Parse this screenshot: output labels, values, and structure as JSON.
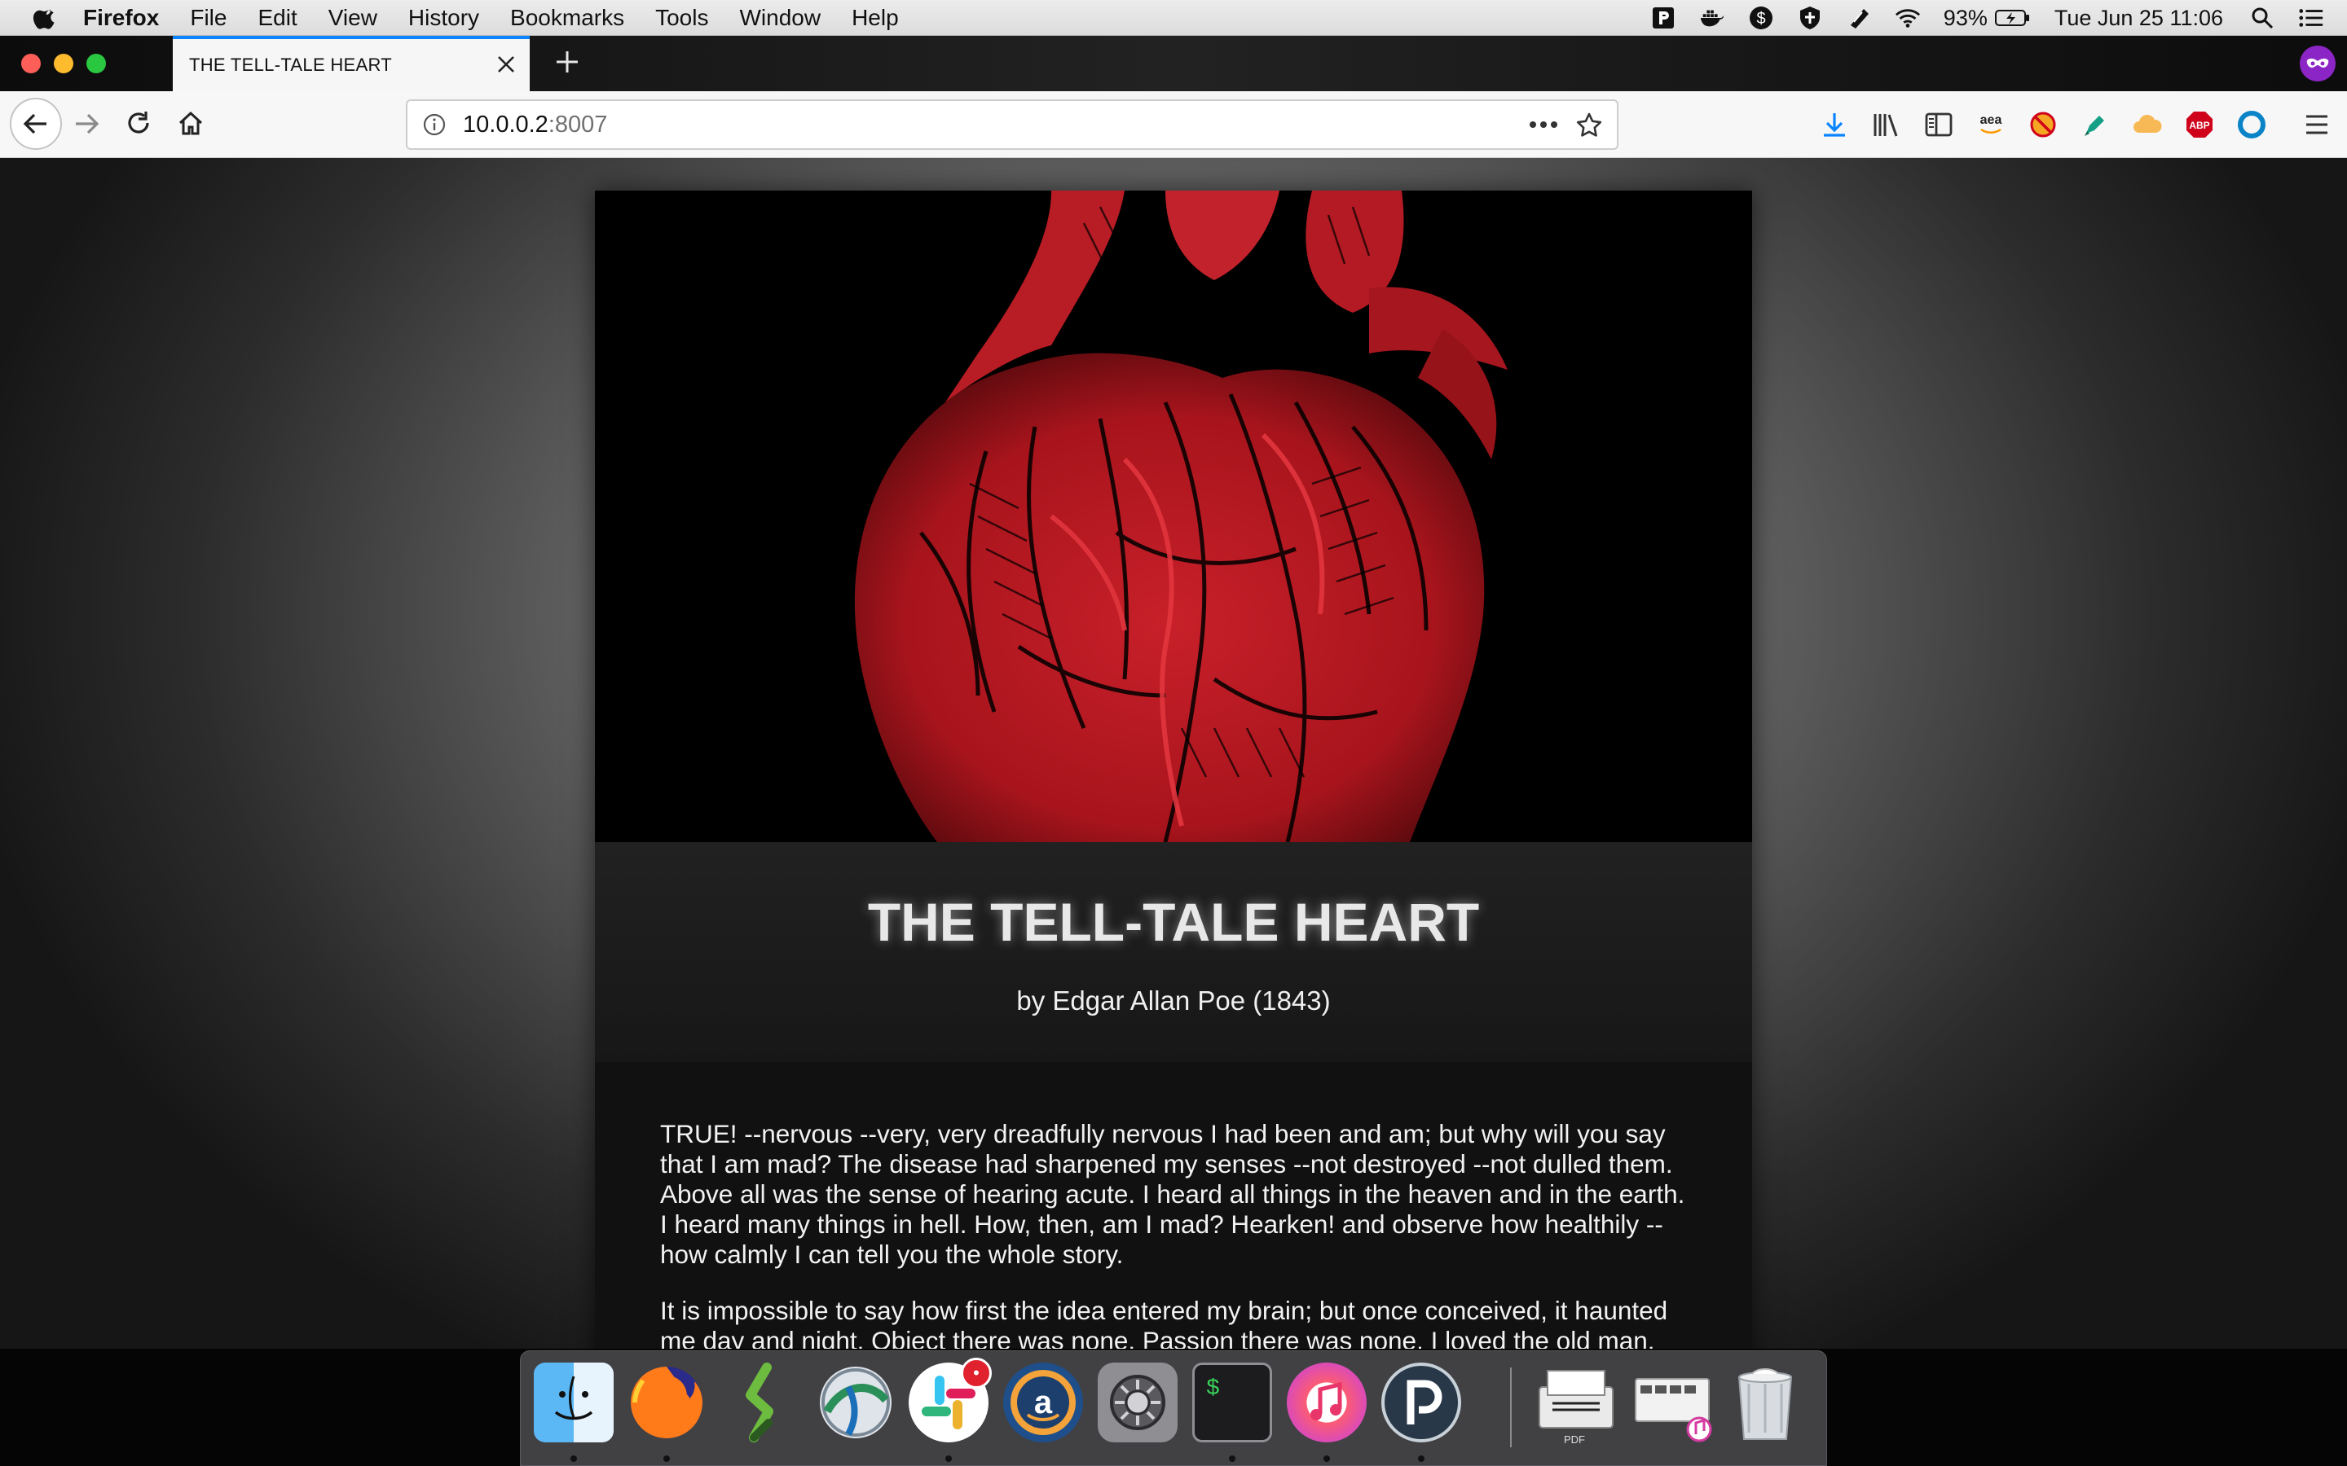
{
  "menubar": {
    "app_name": "Firefox",
    "menus": [
      "File",
      "Edit",
      "View",
      "History",
      "Bookmarks",
      "Tools",
      "Window",
      "Help"
    ],
    "battery_percent": "93%",
    "datetime": "Tue Jun 25  11:06"
  },
  "browser": {
    "tab_title": "THE TELL-TALE HEART",
    "url_host": "10.0.0.2",
    "url_port": ":8007",
    "toolbar_icons": [
      "downloads-icon",
      "library-icon",
      "sidebar-icon",
      "amazon-assistant-icon",
      "disconnect-icon",
      "pen-tool-icon",
      "cloud-icon",
      "adblock-plus-icon",
      "extension-circle-icon",
      "hamburger-menu-icon"
    ],
    "amazon_label": "aea",
    "abp_label": "ABP"
  },
  "story": {
    "title": "THE TELL-TALE HEART",
    "author": "by Edgar Allan Poe (1843)",
    "paragraphs": [
      "TRUE! --nervous --very, very dreadfully nervous I had been and am; but why will you say that I am mad? The disease had sharpened my senses --not destroyed --not dulled them. Above all was the sense of hearing acute. I heard all things in the heaven and in the earth. I heard many things in hell. How, then, am I mad? Hearken! and observe how healthily --how calmly I can tell you the whole story.",
      "It is impossible to say how first the idea entered my brain; but once conceived, it haunted me day and night. Object there was none. Passion there was none. I loved the old man."
    ]
  },
  "dock": {
    "apps": [
      "finder",
      "firefox",
      "scrivener",
      "cisco-anyconnect",
      "slack",
      "amazon-assistant",
      "system-preferences",
      "terminal",
      "itunes",
      "plex"
    ],
    "running": [
      "finder",
      "firefox",
      "slack",
      "terminal",
      "itunes",
      "plex"
    ],
    "slack_badge": "•",
    "terminal_label": "$",
    "pdf_label": "PDF"
  }
}
